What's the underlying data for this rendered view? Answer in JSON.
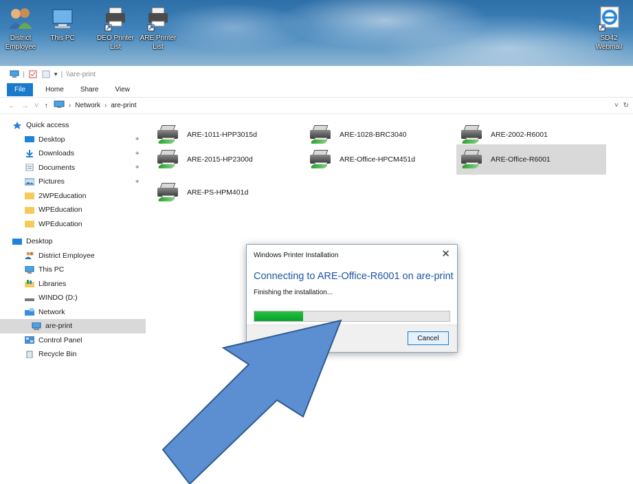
{
  "desktop": {
    "icons": [
      {
        "name": "district-employee",
        "label_line1": "District",
        "label_line2": "Employee"
      },
      {
        "name": "this-pc",
        "label_line1": "This PC",
        "label_line2": ""
      },
      {
        "name": "deo-printer-list",
        "label_line1": "DEO Printer",
        "label_line2": "List"
      },
      {
        "name": "are-printer-list",
        "label_line1": "ARE Printer",
        "label_line2": "List"
      },
      {
        "name": "sd42-webmail",
        "label_line1": "SD42",
        "label_line2": "Webmail"
      }
    ]
  },
  "explorer": {
    "title_path": "\\\\are-print",
    "ribbon_tabs": [
      "File",
      "Home",
      "Share",
      "View"
    ],
    "breadcrumb": [
      "Network",
      "are-print"
    ],
    "nav": {
      "quick_access": "Quick access",
      "quick_items": [
        {
          "label": "Desktop",
          "icon": "desktop-icon",
          "pinned": true
        },
        {
          "label": "Downloads",
          "icon": "downloads-icon",
          "pinned": true
        },
        {
          "label": "Documents",
          "icon": "documents-icon",
          "pinned": true
        },
        {
          "label": "Pictures",
          "icon": "pictures-icon",
          "pinned": true
        },
        {
          "label": "2WPEducation",
          "icon": "folder-icon",
          "pinned": false
        },
        {
          "label": "WPEducation",
          "icon": "folder-icon",
          "pinned": false
        },
        {
          "label": "WPEducation",
          "icon": "folder-icon",
          "pinned": false
        }
      ],
      "desktop_root": "Desktop",
      "desktop_items": [
        {
          "label": "District Employee",
          "icon": "user-icon"
        },
        {
          "label": "This PC",
          "icon": "pc-icon"
        },
        {
          "label": "Libraries",
          "icon": "libraries-icon"
        },
        {
          "label": "WINDO (D:)",
          "icon": "drive-icon"
        },
        {
          "label": "Network",
          "icon": "network-icon"
        },
        {
          "label": "are-print",
          "icon": "computer-icon",
          "selected": true
        },
        {
          "label": "Control Panel",
          "icon": "control-panel-icon"
        },
        {
          "label": "Recycle Bin",
          "icon": "recycle-bin-icon"
        }
      ]
    },
    "printers": [
      {
        "name": "ARE-1011-HPP3015d"
      },
      {
        "name": "ARE-1028-BRC3040"
      },
      {
        "name": "ARE-2002-R6001"
      },
      {
        "name": "ARE-2015-HP2300d"
      },
      {
        "name": "ARE-Office-HPCM451d"
      },
      {
        "name": "ARE-Office-R6001",
        "selected": true
      },
      {
        "name": "ARE-PS-HPM401d"
      }
    ]
  },
  "dialog": {
    "title": "Windows Printer Installation",
    "close_glyph": "✕",
    "heading": "Connecting to ARE-Office-R6001 on are-print",
    "status": "Finishing the installation...",
    "progress_fraction": 0.25,
    "cancel_label": "Cancel"
  },
  "colors": {
    "accent": "#1979ca",
    "heading_blue": "#1e55a3",
    "progress_green": "#06b025",
    "arrow_fill": "#5b8fd1",
    "arrow_stroke": "#2f5b8f"
  }
}
